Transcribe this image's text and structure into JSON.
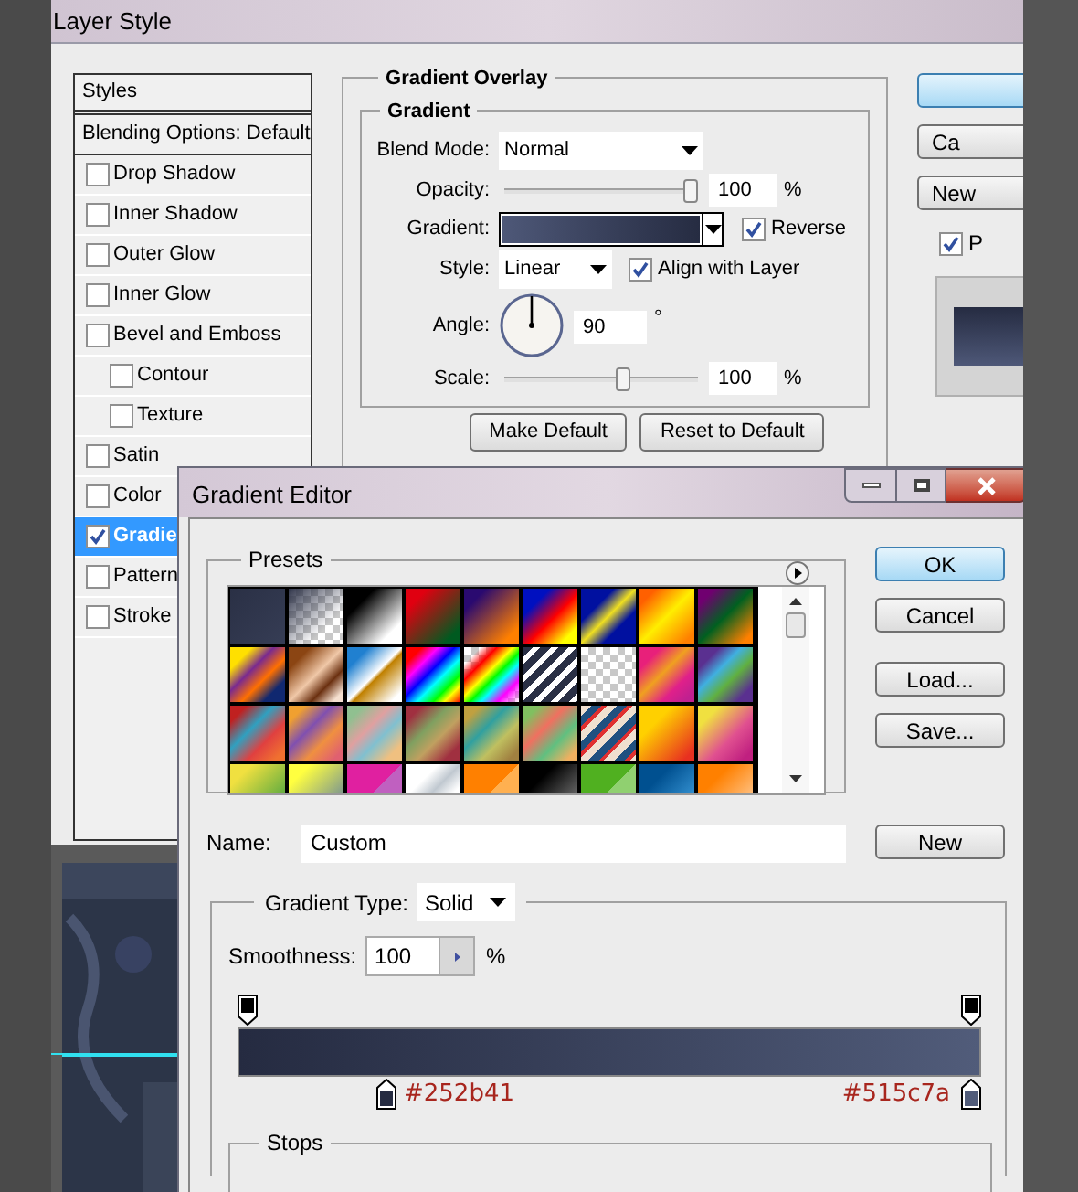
{
  "layer_style": {
    "title": "Layer Style",
    "sidebar": {
      "header": "Styles",
      "blending": "Blending Options: Default",
      "items": [
        {
          "label": "Drop Shadow",
          "checked": false,
          "selected": false
        },
        {
          "label": "Inner Shadow",
          "checked": false,
          "selected": false
        },
        {
          "label": "Outer Glow",
          "checked": false,
          "selected": false
        },
        {
          "label": "Inner Glow",
          "checked": false,
          "selected": false
        },
        {
          "label": "Bevel and Emboss",
          "checked": false,
          "selected": false,
          "children": [
            {
              "label": "Contour",
              "checked": false,
              "selected": false
            },
            {
              "label": "Texture",
              "checked": false,
              "selected": false
            }
          ]
        },
        {
          "label": "Satin",
          "checked": false,
          "selected": false
        },
        {
          "label": "Color",
          "checked": false,
          "selected": false
        },
        {
          "label": "Gradie",
          "checked": true,
          "selected": true
        },
        {
          "label": "Pattern",
          "checked": false,
          "selected": false
        },
        {
          "label": "Stroke",
          "checked": false,
          "selected": false
        }
      ]
    },
    "panel": {
      "title": "Gradient Overlay",
      "group": "Gradient",
      "blend_mode": {
        "label": "Blend Mode:",
        "value": "Normal"
      },
      "opacity": {
        "label": "Opacity:",
        "level": 1,
        "value": "100",
        "unit": "%"
      },
      "gradient": {
        "label": "Gradient:",
        "reverse": {
          "label": "Reverse",
          "checked": true
        }
      },
      "style": {
        "label": "Style:",
        "value": "Linear",
        "align": {
          "label": "Align with Layer",
          "checked": true
        }
      },
      "angle": {
        "label": "Angle:",
        "value": "90",
        "unit": "°"
      },
      "scale": {
        "label": "Scale:",
        "level": 0.62,
        "value": "100",
        "unit": "%"
      },
      "buttons": [
        "Make Default",
        "Reset to Default"
      ]
    },
    "side_buttons": [
      "Ca",
      "New"
    ],
    "preview": {
      "label": "P",
      "checked": true
    }
  },
  "gradient_editor": {
    "title": "Gradient Editor",
    "presets": {
      "label": "Presets"
    },
    "buttons": [
      "OK",
      "Cancel",
      "Load...",
      "Save..."
    ],
    "name": {
      "label": "Name:",
      "value": "Custom"
    },
    "new_button": "New",
    "gradient_type": {
      "label": "Gradient Type:",
      "value": "Solid"
    },
    "smoothness": {
      "label": "Smoothness:",
      "value": "100",
      "unit": "%"
    },
    "color_stops": [
      "#252b41",
      "#515c7a"
    ],
    "stops": {
      "label": "Stops"
    }
  }
}
